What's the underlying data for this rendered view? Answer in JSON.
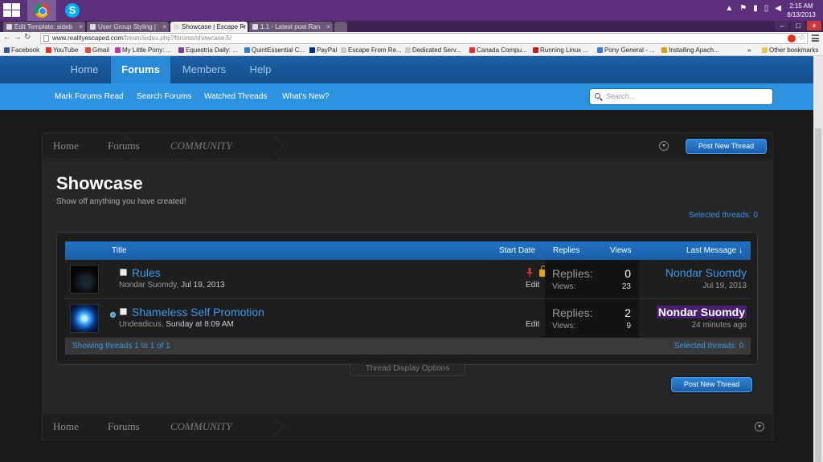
{
  "taskbar": {
    "time": "2:15 AM",
    "date": "8/13/2013",
    "apps": [
      "chrome-icon",
      "skype-icon"
    ]
  },
  "tabs": [
    {
      "title": "Edit Template: sideb"
    },
    {
      "title": "User Group Styling |"
    },
    {
      "title": "Showcase | Escape Fr"
    },
    {
      "title": "1.1 - Latest post Ran"
    }
  ],
  "address": {
    "host": "www.realityescaped.com",
    "path": "/forum/index.php?forums/showcase.5/"
  },
  "bookmarks": [
    {
      "label": "Facebook",
      "color": "#3b5998"
    },
    {
      "label": "YouTube",
      "color": "#e52d27"
    },
    {
      "label": "Gmail",
      "color": "#dd4b39"
    },
    {
      "label": "My Little Pony: ...",
      "color": "#c0399f"
    },
    {
      "label": "Equestria Daily: ...",
      "color": "#7a3d9a"
    },
    {
      "label": "QuintEssential C...",
      "color": "#3a7bd5"
    },
    {
      "label": "PayPal",
      "color": "#003087"
    },
    {
      "label": "Escape From Re...",
      "color": "#cccccc"
    },
    {
      "label": "Dedicated Serv...",
      "color": "#cccccc"
    },
    {
      "label": "Canada Compu...",
      "color": "#d33"
    },
    {
      "label": "Running Linux ...",
      "color": "#b22"
    },
    {
      "label": "Pony General - ...",
      "color": "#3a7bd5"
    },
    {
      "label": "Installing Apach...",
      "color": "#d4a017"
    }
  ],
  "other_bookmarks": "Other bookmarks",
  "nav": {
    "tabs": [
      "Home",
      "Forums",
      "Members",
      "Help"
    ],
    "active": "Forums",
    "sublinks": [
      "Mark Forums Read",
      "Search Forums",
      "Watched Threads",
      "What's New?"
    ],
    "search_placeholder": "Search..."
  },
  "breadcrumb": [
    "Home",
    "Forums",
    "COMMUNITY"
  ],
  "buttons": {
    "post_new_thread": "Post New Thread"
  },
  "forum": {
    "title": "Showcase",
    "description": "Show off anything you have created!",
    "selected_threads": "Selected threads: 0"
  },
  "table": {
    "headers": {
      "title": "Title",
      "start_date": "Start Date",
      "replies": "Replies",
      "views": "Views",
      "last_message": "Last Message ↓"
    },
    "rows": [
      {
        "title": "Rules",
        "author": "Nondar Suomdy,",
        "date": "Jul 19, 2013",
        "edit": "Edit",
        "replies_label": "Replies:",
        "replies": "0",
        "views_label": "Views:",
        "views": "23",
        "last_user": "Nondar Suomdy",
        "last_date": "Jul 19, 2013"
      },
      {
        "title": "Shameless Self Promotion",
        "author": "Undeadicus,",
        "date": "Sunday at 8:09 AM",
        "edit": "Edit",
        "replies_label": "Replies:",
        "replies": "2",
        "views_label": "Views:",
        "views": "9",
        "last_user": "Nondar Suomdy",
        "last_date": "24 minutes ago"
      }
    ],
    "footer_left": "Showing threads 1 to 1 of 1",
    "footer_right": "Selected threads: 0"
  },
  "display_options": "Thread Display Options",
  "colors": {
    "accent": "#3a9ae8",
    "nav_dark": "#1b5fa3",
    "nav_light": "#2d93e0",
    "highlight_user": "#4a1e6e"
  }
}
